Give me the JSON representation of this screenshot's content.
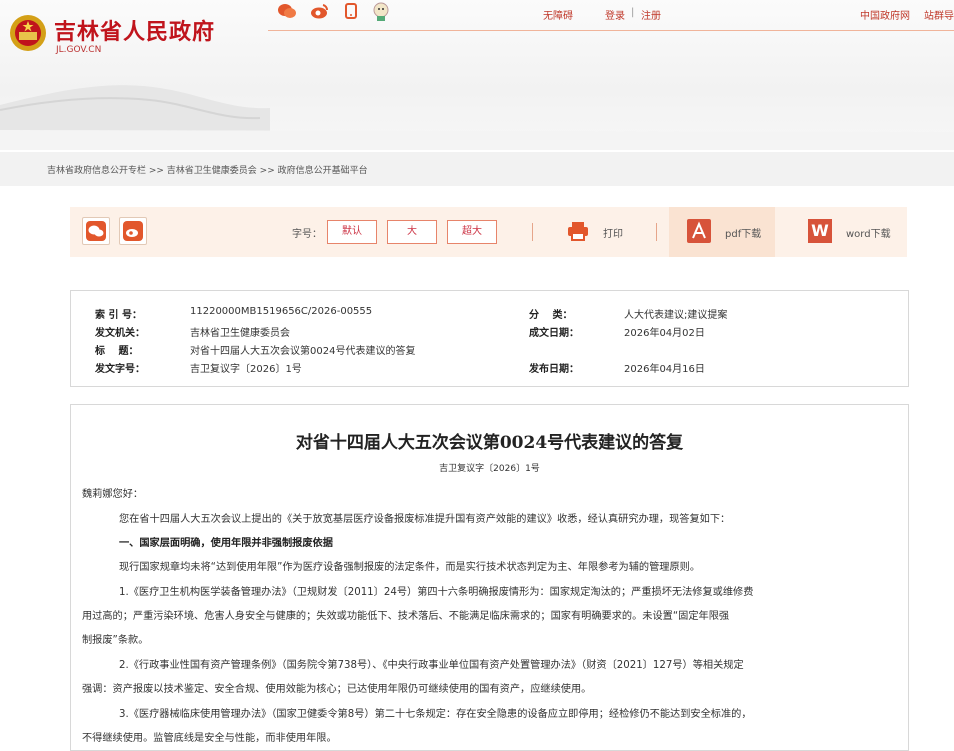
{
  "site": {
    "title": "吉林省人民政府",
    "subtitle": "JL.GOV.CN"
  },
  "topnav": {
    "accessibility": "无障碍",
    "login": "登录",
    "divider": "|",
    "register": "注册",
    "central_gov": "中国政府网",
    "site_group": "站群导"
  },
  "breadcrumb": "吉林省政府信息公开专栏 >> 吉林省卫生健康委员会 >> 政府信息公开基础平台",
  "toolbar": {
    "font_size_label": "字号：",
    "default": "默认",
    "large": "大",
    "xlarge": "超大",
    "print": "打印",
    "pdf": "pdf下载",
    "word": "word下载",
    "word_glyph": "W"
  },
  "meta": {
    "index_label": "索 引 号：",
    "index_value": "11220000MB1519656C/2026-00555",
    "category_label": "分　 类：",
    "category_value": "人大代表建议;建议提案",
    "agency_label": "发文机关：",
    "agency_value": "吉林省卫生健康委员会",
    "date_label": "成文日期：",
    "date_value": "2026年04月02日",
    "title_label": "标　 题：",
    "title_value": "对省十四届人大五次会议第0024号代表建议的答复",
    "docno_label": "发文字号：",
    "docno_value": "吉卫复议字〔2026〕1号",
    "publish_label": "发布日期：",
    "publish_value": "2026年04月16日"
  },
  "article": {
    "title": "对省十四届人大五次会议第0024号代表建议的答复",
    "doc_no": "吉卫复议字〔2026〕1号",
    "lines": [
      "魏莉娜您好：",
      "您在省十四届人大五次会议上提出的《关于放宽基层医疗设备报废标准提升国有资产效能的建议》收悉，经认真研究办理，现答复如下：",
      "一、国家层面明确，使用年限并非强制报废依据",
      "现行国家规章均未将“达到使用年限”作为医疗设备强制报废的法定条件，而是实行技术状态判定为主、年限参考为辅的管理原则。",
      "1.《医疗卫生机构医学装备管理办法》（卫规财发〔2011〕24号）第四十六条明确报废情形为：国家规定淘汰的；严重损坏无法修复或维修费",
      "用过高的；严重污染环境、危害人身安全与健康的；失效或功能低下、技术落后、不能满足临床需求的；国家有明确要求的。未设置“固定年限强",
      "制报废”条款。",
      "2.《行政事业性国有资产管理条例》（国务院令第738号）、《中央行政事业单位国有资产处置管理办法》（财资〔2021〕127号）等相关规定",
      "强调：资产报废以技术鉴定、安全合规、使用效能为核心；已达使用年限仍可继续使用的国有资产，应继续使用。",
      "3.《医疗器械临床使用管理办法》（国家卫健委令第8号）第二十七条规定：存在安全隐患的设备应立即停用；经检修仍不能达到安全标准的，",
      "不得继续使用。监管底线是安全与性能，而非使用年限。"
    ]
  },
  "colors": {
    "brand_red": "#c0141c",
    "accent_orange": "#e2572c",
    "toolbar_bg": "#fdf1e8"
  }
}
